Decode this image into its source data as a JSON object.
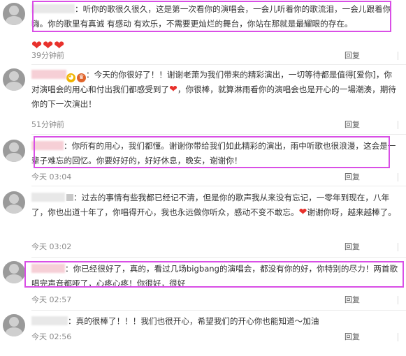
{
  "comments": [
    {
      "text": "：听你的歌很久很久，这是第一次看你的演唱会，一会儿听着你的歌流泪，一会儿跟着你嗨。你的歌里有真诚 有感动 有欢乐，不需要更灿烂的舞台，你站在那就是最耀眼的存在。",
      "hearts": "❤❤❤",
      "time": "39分钟前",
      "reply": "回复",
      "likes": "1"
    },
    {
      "text": "：今天的你很好了！！谢谢老萧为我们带来的精彩演出，一切等待都是值得[爱你]，你对演唱会的用心和付出我们都感受到了",
      "text_tail": "，你很棒，就算淋雨看你的演唱会也是开心的一場潮湊，期待你的下一次演出！",
      "time": "51分钟前",
      "reply": "回复",
      "likes": "1"
    },
    {
      "text": "：你所有的用心，我们都懂。谢谢你带给我们如此精彩的演出，雨中听歌也很浪漫，这会是一辈子难忘的回忆。你要好好的，好好休息，晚安，谢谢你！",
      "time": "今天 03:04",
      "reply": "回复",
      "likes": "1"
    },
    {
      "text": "：过去的事情有些我都已经记不清，但是你的歌声我从来没有忘记，一零年到现在，八年了，你也出道十年了，你唱得开心，我也永远做你听众，感动不变不敢忘。",
      "text_tail": "谢谢你呀，越来越棒了。",
      "time": "今天 03:02",
      "reply": "回复",
      "likes": "1"
    },
    {
      "text": "：你已经很好了，真的，看过几场bigbang的演唱会，都没有你的好，你特别的尽力！两首歌唱完声音都哑了，心疼心疼！你很好，很好",
      "time": "今天 02:57",
      "reply": "回复",
      "likes": "1"
    },
    {
      "text": "：真的很棒了！！！我们也很开心，希望我们的开心你也能知道～加油",
      "time": "今天 02:56",
      "reply": "回复",
      "likes": "1"
    }
  ],
  "icons": {
    "heart": "❤",
    "like": "thumbs-up-icon"
  },
  "colors": {
    "highlight": "#d94fe6",
    "heart": "#e8312c"
  }
}
